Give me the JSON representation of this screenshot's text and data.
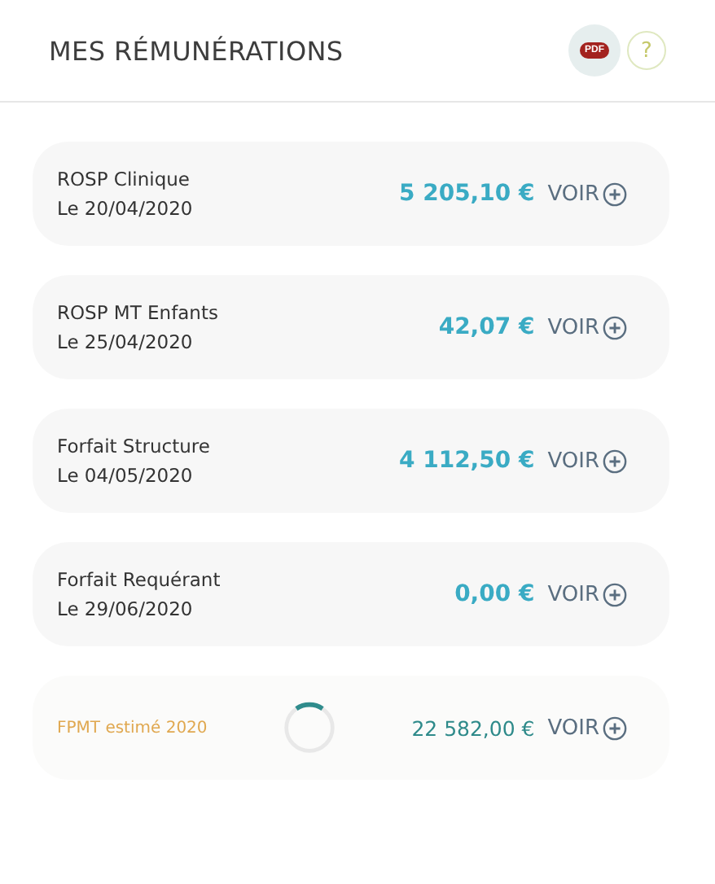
{
  "header": {
    "title": "MES RÉMUNÉRATIONS",
    "pdf_label": "PDF",
    "help_label": "?"
  },
  "items": [
    {
      "kind": "payment",
      "label": "ROSP Clinique",
      "date": "Le 20/04/2020",
      "amount": "5 205,10 €",
      "action": "VOIR"
    },
    {
      "kind": "payment",
      "label": "ROSP MT Enfants",
      "date": "Le 25/04/2020",
      "amount": "42,07 €",
      "action": "VOIR"
    },
    {
      "kind": "payment",
      "label": "Forfait Structure",
      "date": "Le 04/05/2020",
      "amount": "4 112,50 €",
      "action": "VOIR"
    },
    {
      "kind": "payment",
      "label": "Forfait Requérant",
      "date": "Le 29/06/2020",
      "amount": "0,00 €",
      "action": "VOIR"
    },
    {
      "kind": "estimate",
      "label": "FPMT estimé 2020",
      "amount": "22 582,00 €",
      "action": "VOIR"
    }
  ]
}
